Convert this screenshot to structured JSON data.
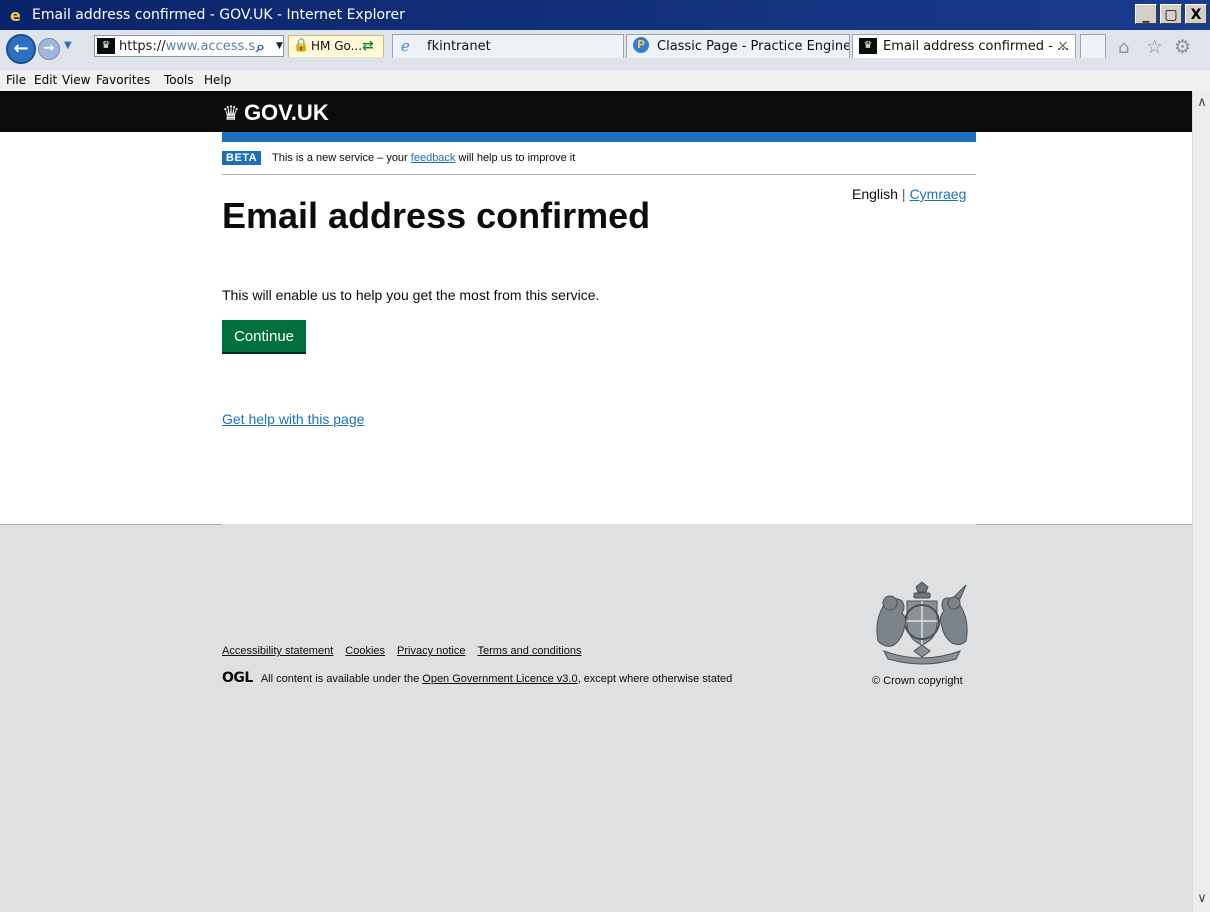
{
  "window": {
    "title": "Email address confirmed - GOV.UK - Internet Explorer",
    "minimize": "_",
    "maximize": "̅□",
    "close": "X"
  },
  "toolbar": {
    "address_prefix": "https://",
    "address_rest": "www.access.s",
    "security_label": "HM Go...",
    "tabs": [
      {
        "label": "fkintranet"
      },
      {
        "label": "Classic Page - Practice Engine"
      },
      {
        "label": "Email address confirmed - ...",
        "close": "×"
      }
    ]
  },
  "menu": [
    "File",
    "Edit",
    "View",
    "Favorites",
    "Tools",
    "Help"
  ],
  "site": {
    "logo_text": "GOV.UK",
    "phase_tag": "BETA",
    "phase_text_before": "This is a new service – your ",
    "phase_link": "feedback",
    "phase_text_after": " will help us to improve it",
    "lang_current": "English",
    "lang_separator": "|",
    "lang_other": "Cymraeg"
  },
  "main": {
    "heading": "Email address confirmed",
    "body": "This will enable us to help you get the most from this service.",
    "continue_label": "Continue",
    "help_link": "Get help with this page"
  },
  "footer": {
    "links": [
      "Accessibility statement",
      "Cookies",
      "Privacy notice",
      "Terms and conditions"
    ],
    "ogl_logo": "OGL",
    "licence_before": "All content is available under the ",
    "licence_link": "Open Government Licence v3.0",
    "licence_after": ", except where otherwise stated",
    "copyright": "© Crown copyright"
  },
  "colors": {
    "header_black": "#0b0c0c",
    "brand_blue": "#1d70b8",
    "button_green": "#00703c",
    "footer_grey": "#dee0e2"
  }
}
